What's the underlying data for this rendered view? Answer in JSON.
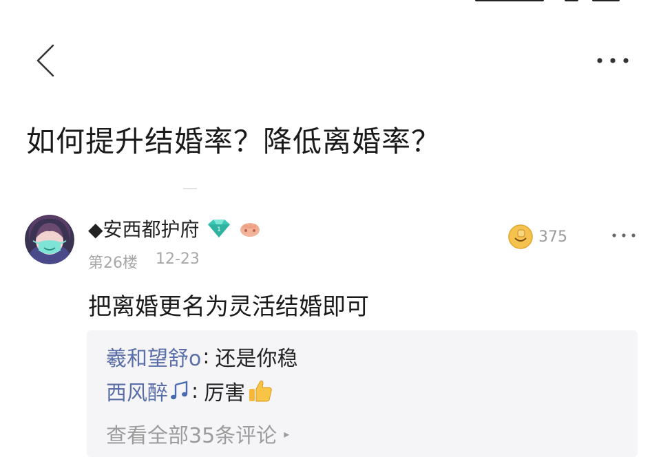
{
  "question": {
    "title": "如何提升结婚率？降低离婚率？"
  },
  "answer": {
    "username": "◆安西都护府",
    "floor": "第26楼",
    "date": "12-23",
    "like_count": "375",
    "content": "把离婚更名为灵活结婚即可"
  },
  "comments": {
    "items": [
      {
        "name": "羲和望舒o",
        "separator": ":",
        "text": "还是你稳",
        "emoji": ""
      },
      {
        "name": "西风醉",
        "separator": ":",
        "text": "厉害",
        "emoji": "👍"
      }
    ],
    "view_all_label": "查看全部35条评论",
    "view_all_caret": "▸"
  },
  "icons": {
    "back": "chevron-left-icon",
    "more": "more-horizontal-icon",
    "badge": "diamond-badge-icon",
    "medal": "fist-badge-icon",
    "like": "like-emoji-icon",
    "music": "music-note-icon",
    "thumb": "thumbs-up-icon"
  },
  "colors": {
    "name_link": "#5a6ea8",
    "meta_gray": "#a7a7a7",
    "comment_bg": "#f5f5f7",
    "badge_green": "#3ac7b3"
  }
}
